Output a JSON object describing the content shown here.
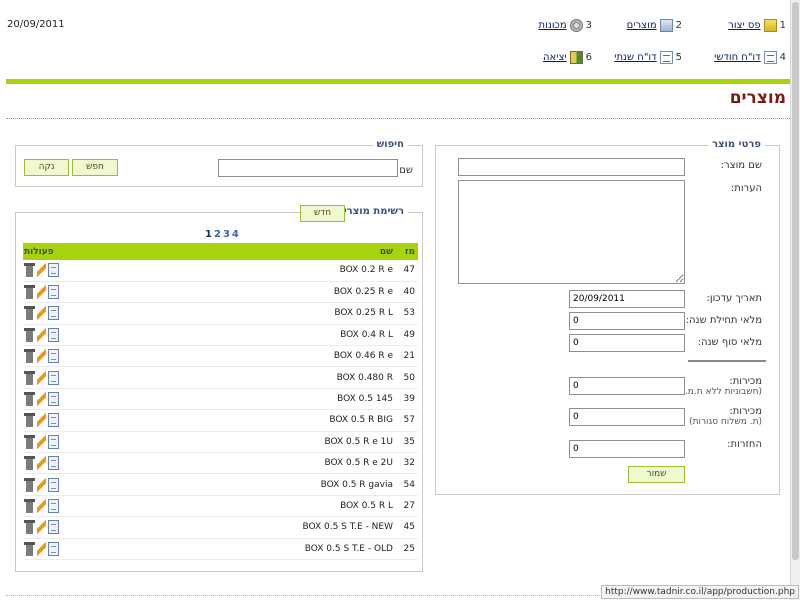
{
  "date": "20/09/2011",
  "nav": {
    "items": [
      {
        "num": "1",
        "label": "פס יצור",
        "icon": "folder-icon"
      },
      {
        "num": "2",
        "label": "מוצרים",
        "icon": "window-icon"
      },
      {
        "num": "3",
        "label": "מכונות",
        "icon": "gear-icon"
      },
      {
        "num": "4",
        "label": "דו\"ח חודשי",
        "icon": "document-icon"
      },
      {
        "num": "5",
        "label": "דו\"ח שנתי",
        "icon": "document-icon"
      },
      {
        "num": "6",
        "label": "יציאה",
        "icon": "exit-icon"
      }
    ]
  },
  "page_title": "מוצרים",
  "product_details": {
    "legend": "פרטי מוצר",
    "name_label": "שם מוצר:",
    "name_value": "",
    "notes_label": "הערות:",
    "notes_value": "",
    "update_date_label": "תאריך עדכון:",
    "update_date_value": "20/09/2011",
    "year_start_stock_label": "מלאי תחילת שנה:",
    "year_start_stock_value": "0",
    "year_end_stock_label": "מלאי סוף שנה:",
    "year_end_stock_value": "0",
    "sales_label": "מכירות:",
    "sales_note": "(חשבוניות ללא ת.מ.)",
    "sales_value": "0",
    "sales2_label": "מכירות:",
    "sales2_note": "(ת. משלוח סגורות)",
    "sales2_value": "0",
    "returns_label": "החזרות:",
    "returns_value": "0",
    "save_label": "שמור"
  },
  "search": {
    "legend": "חיפוש",
    "name_label": "שם:",
    "name_value": "",
    "search_button": "חפש",
    "clear_button": "נקה"
  },
  "product_list": {
    "legend": "רשימת מוצרים",
    "new_button": "חדש",
    "pages": [
      "1",
      "2",
      "3",
      "4"
    ],
    "current_page": "1",
    "columns": {
      "id": "מז",
      "name": "שם",
      "actions": "פעולות"
    },
    "rows": [
      {
        "id": "47",
        "name": "BOX 0.2 R e"
      },
      {
        "id": "40",
        "name": "BOX 0.25 R e"
      },
      {
        "id": "53",
        "name": "BOX 0.25 R L"
      },
      {
        "id": "49",
        "name": "BOX 0.4 R L"
      },
      {
        "id": "21",
        "name": "BOX 0.46 R e"
      },
      {
        "id": "50",
        "name": "BOX 0.480 R"
      },
      {
        "id": "39",
        "name": "BOX 0.5 145"
      },
      {
        "id": "57",
        "name": "BOX 0.5 R BIG"
      },
      {
        "id": "35",
        "name": "BOX 0.5 R e 1U"
      },
      {
        "id": "32",
        "name": "BOX 0.5 R e 2U"
      },
      {
        "id": "54",
        "name": "BOX 0.5 R gavia"
      },
      {
        "id": "27",
        "name": "BOX 0.5 R L"
      },
      {
        "id": "45",
        "name": "BOX 0.5 S T.E - NEW"
      },
      {
        "id": "25",
        "name": "BOX 0.5 S T.E - OLD"
      }
    ]
  },
  "status_url": "http://www.tadnir.co.il/app/production.php",
  "colors": {
    "accent_green": "#a8d10e",
    "title_red": "#7a1c12",
    "legend_blue": "#3b4f7a"
  }
}
